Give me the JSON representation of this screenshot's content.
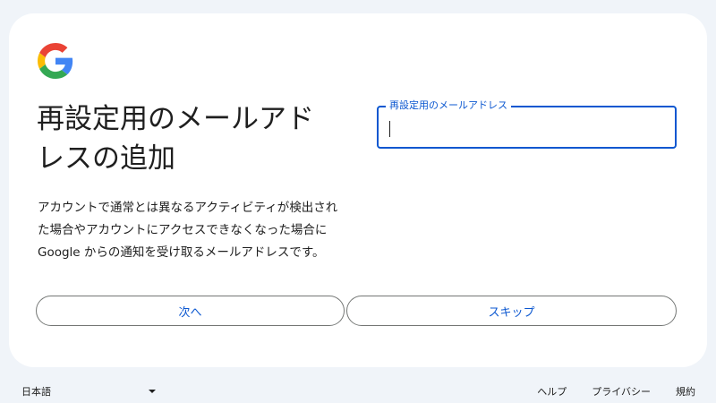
{
  "brand": {
    "logo_icon": "google-g-logo-icon"
  },
  "heading": {
    "title": "再設定用のメールアドレスの追加"
  },
  "description": "アカウントで通常とは異なるアクティビティが検出された場合やアカウントにアクセスできなくなった場合に Google からの通知を受け取るメールアドレスです。",
  "email_field": {
    "label": "再設定用のメールアドレス",
    "value": ""
  },
  "buttons": {
    "next": "次へ",
    "skip": "スキップ"
  },
  "footer": {
    "language": "日本語",
    "language_icon": "dropdown-arrow-icon",
    "links": [
      "ヘルプ",
      "プライバシー",
      "規約"
    ]
  },
  "colors": {
    "accent": "#0b57d0",
    "background": "#f0f4f9",
    "card": "#ffffff"
  }
}
